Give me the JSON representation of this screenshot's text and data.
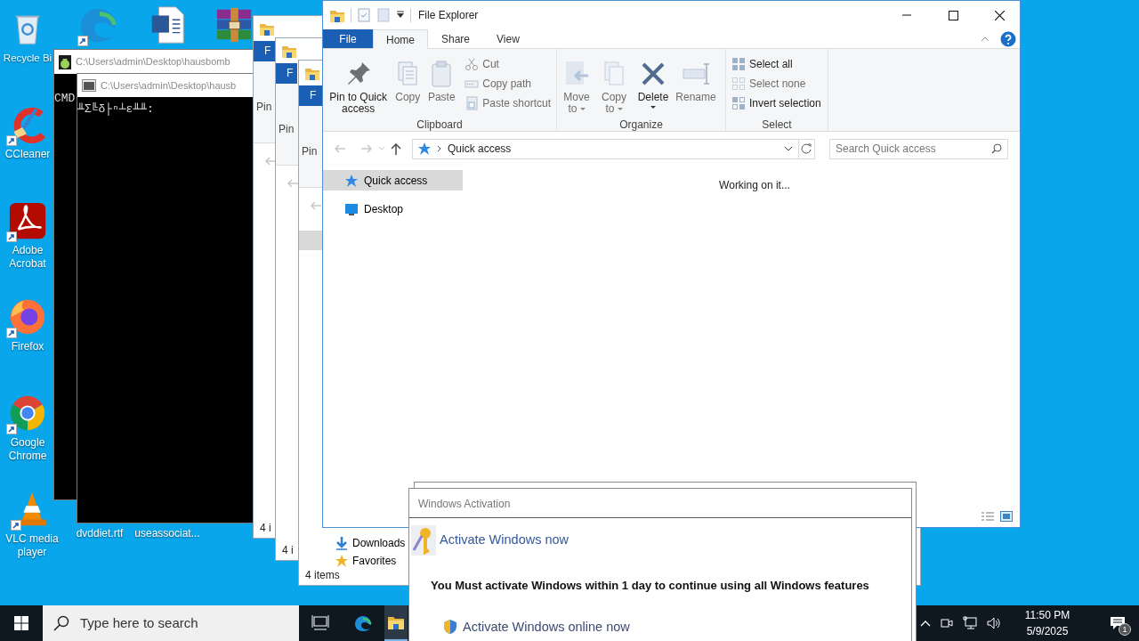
{
  "desktop_icons": [
    {
      "label": "Recycle Bi",
      "shortcut": false
    },
    {
      "label": "CCleaner",
      "shortcut": true
    },
    {
      "label": "Adobe Acrobat",
      "shortcut": true
    },
    {
      "label": "Firefox",
      "shortcut": true
    },
    {
      "label": "Google Chrome",
      "shortcut": true
    },
    {
      "label": "VLC media player",
      "shortcut": true
    },
    {
      "shortcut": true
    },
    {
      "shortcut": false
    },
    {
      "shortcut": false
    },
    {
      "label": "dvddiet.rtf"
    },
    {
      "label": "useassociat..."
    }
  ],
  "console_windows": [
    {
      "title": "C:\\Users\\admin\\Desktop\\hausbomb",
      "text": "CMD"
    },
    {
      "title": "C:\\Users\\admin\\Desktop\\hausb",
      "text": "╨Σ╚δ├ⁿ┴ε╨╨:"
    }
  ],
  "background_explorers": [
    {
      "tab": "F",
      "button": "Pin",
      "status": "4 i",
      "nav_highlight": false
    },
    {
      "tab": "F",
      "button": "Pin",
      "status": "4 i",
      "nav_highlight": false
    },
    {
      "tab": "F",
      "button": "Pin",
      "status": "4 items",
      "nav_highlight": true,
      "nav": [
        "Downloads",
        "Favorites"
      ]
    }
  ],
  "explorer": {
    "title": "File Explorer",
    "tabs": [
      {
        "label": "File",
        "kind": "file",
        "selected": false
      },
      {
        "label": "Home",
        "kind": "tab",
        "selected": true
      },
      {
        "label": "Share",
        "kind": "tab",
        "selected": false
      },
      {
        "label": "View",
        "kind": "tab",
        "selected": false
      }
    ],
    "ribbon_groups": [
      {
        "label": "Clipboard",
        "items": [
          {
            "kind": "large",
            "label": "Pin to Quick access",
            "disabled": false,
            "dropdown": false
          },
          {
            "kind": "large",
            "label": "Copy",
            "disabled": true,
            "dropdown": false
          },
          {
            "kind": "large",
            "label": "Paste",
            "disabled": true,
            "dropdown": false
          },
          {
            "kind": "small",
            "label": "Cut",
            "disabled": true
          },
          {
            "kind": "small",
            "label": "Copy path",
            "disabled": true
          },
          {
            "kind": "small",
            "label": "Paste shortcut",
            "disabled": true
          }
        ]
      },
      {
        "label": "Organize",
        "items": [
          {
            "kind": "large",
            "label": "Move to",
            "disabled": true,
            "dropdown": true
          },
          {
            "kind": "large",
            "label": "Copy to",
            "disabled": true,
            "dropdown": true
          },
          {
            "kind": "large",
            "label": "Delete",
            "disabled": false,
            "dropdown": true
          },
          {
            "kind": "large",
            "label": "Rename",
            "disabled": true,
            "dropdown": false
          }
        ]
      },
      {
        "label": "Select",
        "items": [
          {
            "kind": "small",
            "label": "Select all",
            "disabled": false
          },
          {
            "kind": "small",
            "label": "Select none",
            "disabled": true
          },
          {
            "kind": "small",
            "label": "Invert selection",
            "disabled": false
          }
        ]
      }
    ],
    "address": "Quick access",
    "search": {
      "placeholder": "Search Quick access"
    },
    "nav": [
      {
        "label": "Quick access",
        "selected": true
      },
      {
        "label": "Desktop",
        "selected": false
      }
    ],
    "status_message": "Working on it..."
  },
  "activation": {
    "title": "Windows Activation",
    "heading": "Activate Windows now",
    "message": "You Must activate Windows within 1 day to continue using all Windows features",
    "action": "Activate Windows online now"
  },
  "taskbar": {
    "search": {
      "placeholder": "Type here to search"
    },
    "apps": [
      {
        "selected": false
      },
      {
        "selected": false
      },
      {
        "selected": true
      }
    ],
    "time": "11:50 PM",
    "date": "5/9/2025",
    "notification_count": "1"
  }
}
